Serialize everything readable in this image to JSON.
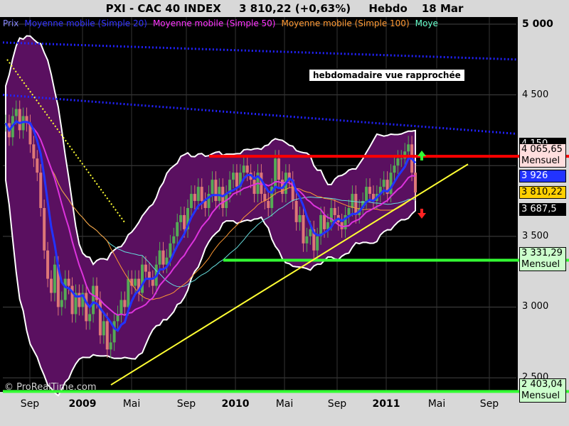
{
  "header": {
    "instrument": "PXI - CAC 40 INDEX",
    "last": "3 810,22 (+0,63%)",
    "period": "Hebdo",
    "date": "18 Mar"
  },
  "legend": {
    "items": [
      {
        "label": "Prix",
        "color": "#8888ff"
      },
      {
        "label": "Moyenne mobile (Simple 20)",
        "color": "#3333ff"
      },
      {
        "label": "Moyenne mobile (Simple 50)",
        "color": "#ff33ff"
      },
      {
        "label": "Moyenne mobile (Simple 100)",
        "color": "#ff9933"
      },
      {
        "label": "Moye",
        "color": "#66ffcc"
      }
    ]
  },
  "annotation": "hebdomadaire vue rapprochée",
  "copyright": "© ProRealTime.com",
  "colors": {
    "background": "#000000",
    "bollinger_fill": "#5a1060",
    "bollinger_edge": "#ffffff",
    "resistance": "#ff0000",
    "support": "#33ff33",
    "trendline": "#ffff33",
    "downtrend_dotted": "#2222ff",
    "ma20": "#2233ff",
    "ma50": "#dd33dd",
    "ma100": "#ff9933",
    "ma200": "#66dddd",
    "candle_up": "#55aa55",
    "candle_down": "#dd7777"
  },
  "chart_data": {
    "type": "candlestick",
    "ylim": [
      2400,
      5050
    ],
    "y_ticks": [
      "5 000",
      "4 500",
      "3 500",
      "3 000",
      "2 500"
    ],
    "x_ticks": [
      {
        "label": "Sep",
        "bold": false
      },
      {
        "label": "2009",
        "bold": true
      },
      {
        "label": "Mai",
        "bold": false
      },
      {
        "label": "Sep",
        "bold": false
      },
      {
        "label": "2010",
        "bold": true
      },
      {
        "label": "Mai",
        "bold": false
      },
      {
        "label": "Sep",
        "bold": false
      },
      {
        "label": "2011",
        "bold": true
      },
      {
        "label": "Mai",
        "bold": false
      },
      {
        "label": "Sep",
        "bold": false
      }
    ],
    "horizontal_levels": [
      {
        "value": 4065.65,
        "label": "4 065,65",
        "sublabel": "Mensuel",
        "color": "#ff0000"
      },
      {
        "value": 3331.29,
        "label": "3 331,29",
        "sublabel": "Mensuel",
        "color": "#33ff33"
      },
      {
        "value": 2403.04,
        "label": "2 403,04",
        "sublabel": "Mensuel",
        "color": "#33ff33"
      }
    ],
    "price_labels": [
      {
        "value": 4150,
        "label": "4 150",
        "bg": "#000000",
        "fg": "#ffffff"
      },
      {
        "value": 3926,
        "label": "3 926",
        "bg": "#2233ff",
        "fg": "#ffffff"
      },
      {
        "value": 3810.22,
        "label": "3 810,22",
        "bg": "#ffd000",
        "fg": "#000000"
      },
      {
        "value": 3687.5,
        "label": "3 687,5",
        "bg": "#000000",
        "fg": "#ffffff"
      }
    ],
    "weekly_close": [
      4300,
      4200,
      4350,
      4400,
      4250,
      4350,
      4300,
      4150,
      4050,
      3950,
      3700,
      3400,
      3200,
      3100,
      3300,
      3000,
      3050,
      3200,
      3150,
      2950,
      3100,
      3000,
      3100,
      2900,
      2950,
      3150,
      3050,
      2800,
      2900,
      2700,
      2750,
      2900,
      2950,
      3050,
      3000,
      3200,
      3150,
      3200,
      3100,
      3300,
      3250,
      3200,
      3150,
      3300,
      3400,
      3300,
      3350,
      3450,
      3500,
      3600,
      3650,
      3550,
      3700,
      3800,
      3750,
      3850,
      3750,
      3700,
      3800,
      3900,
      3750,
      3850,
      3700,
      3800,
      3900,
      3950,
      3850,
      3950,
      4000,
      3950,
      3900,
      3800,
      3950,
      3800,
      3750,
      3700,
      3850,
      4050,
      3900,
      3800,
      3950,
      3900,
      3750,
      3600,
      3650,
      3450,
      3500,
      3550,
      3400,
      3500,
      3650,
      3550,
      3600,
      3700,
      3650,
      3600,
      3550,
      3650,
      3700,
      3800,
      3650,
      3700,
      3750,
      3850,
      3800,
      3750,
      3800,
      3850,
      3900,
      3800,
      3950,
      4000,
      4050,
      4050,
      4100,
      4150,
      3950,
      3810
    ],
    "ma20_series": [
      4320,
      4200,
      4080,
      3950,
      3800,
      3650,
      3500,
      3380,
      3270,
      3180,
      3100,
      3040,
      3000,
      2990,
      2990,
      3020,
      3080,
      3150,
      3220,
      3300,
      3380,
      3450,
      3500,
      3560,
      3610,
      3660,
      3700,
      3740,
      3760,
      3780,
      3790,
      3800,
      3810,
      3820,
      3840,
      3860,
      3880,
      3900,
      3890,
      3850,
      3800,
      3740,
      3680,
      3640,
      3620,
      3600,
      3600,
      3620,
      3640,
      3660,
      3680,
      3700,
      3710,
      3720,
      3730,
      3760,
      3800,
      3850,
      3890,
      3920,
      3926,
      3926
    ],
    "downtrend_start": 4750,
    "downtrend_end": 4870
  }
}
